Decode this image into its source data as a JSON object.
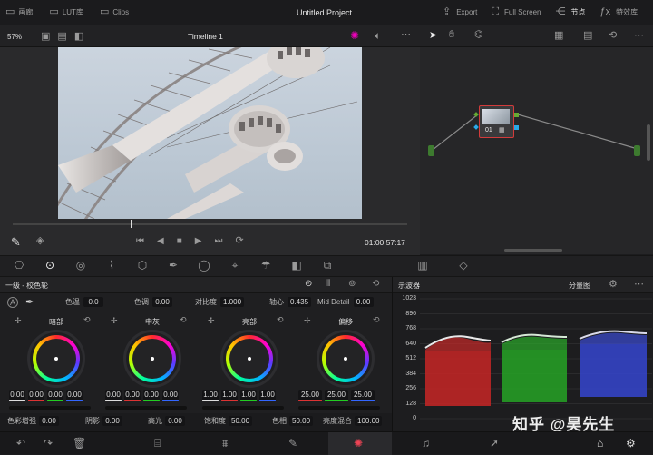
{
  "top": {
    "left_items": [
      {
        "icon": "media-icon",
        "label": "画廊"
      },
      {
        "icon": "lut-icon",
        "label": "LUT库"
      },
      {
        "icon": "clips-icon",
        "label": "Clips"
      }
    ],
    "project_title": "Untitled Project",
    "right_items": [
      {
        "icon": "export-icon",
        "label": "Export"
      },
      {
        "icon": "fullscreen-icon",
        "label": "Full Screen"
      },
      {
        "icon": "nodes-icon",
        "label": "节点"
      },
      {
        "icon": "fx-icon",
        "label": "特效库"
      }
    ]
  },
  "viewer": {
    "zoom": "57%",
    "timeline_name": "Timeline 1",
    "timecode": "01:00:57:17"
  },
  "node": {
    "label": "01"
  },
  "pages": [
    "camera-raw-icon",
    "color-wheel-icon",
    "hdr-icon",
    "curves-icon",
    "color-warper-icon",
    "qualifier-icon",
    "window-icon",
    "tracker-icon",
    "blur-icon",
    "key-icon",
    "sizing-icon",
    "scopes-icon",
    "3d-icon"
  ],
  "color_wheels": {
    "panel_title": "一级 - 校色轮",
    "top_params": [
      {
        "label": "色温",
        "value": "0.0"
      },
      {
        "label": "色调",
        "value": "0.00"
      },
      {
        "label": "对比度",
        "value": "1.000"
      },
      {
        "label": "轴心",
        "value": "0.435"
      },
      {
        "label": "Mid Detail",
        "value": "0.00"
      }
    ],
    "wheels": [
      {
        "name": "暗部",
        "values": [
          "0.00",
          "0.00",
          "0.00",
          "0.00"
        ]
      },
      {
        "name": "中灰",
        "values": [
          "0.00",
          "0.00",
          "0.00",
          "0.00"
        ]
      },
      {
        "name": "亮部",
        "values": [
          "1.00",
          "1.00",
          "1.00",
          "1.00"
        ]
      },
      {
        "name": "偏移",
        "values": [
          "25.00",
          "25.00",
          "25.00"
        ]
      }
    ],
    "bottom_params": [
      {
        "label": "色彩增强",
        "value": "0.00"
      },
      {
        "label": "阴影",
        "value": "0.00"
      },
      {
        "label": "高光",
        "value": "0.00"
      },
      {
        "label": "饱和度",
        "value": "50.00"
      },
      {
        "label": "色相",
        "value": "50.00"
      },
      {
        "label": "亮度混合",
        "value": "100.00"
      }
    ]
  },
  "scopes": {
    "title": "示波器",
    "mode": "分量图",
    "ticks": [
      "1023",
      "896",
      "768",
      "640",
      "512",
      "384",
      "256",
      "128",
      "0"
    ]
  },
  "watermark": "知乎 @昊先生",
  "colors": {
    "accent": "#d23b3b",
    "panel": "#1f1f21"
  }
}
